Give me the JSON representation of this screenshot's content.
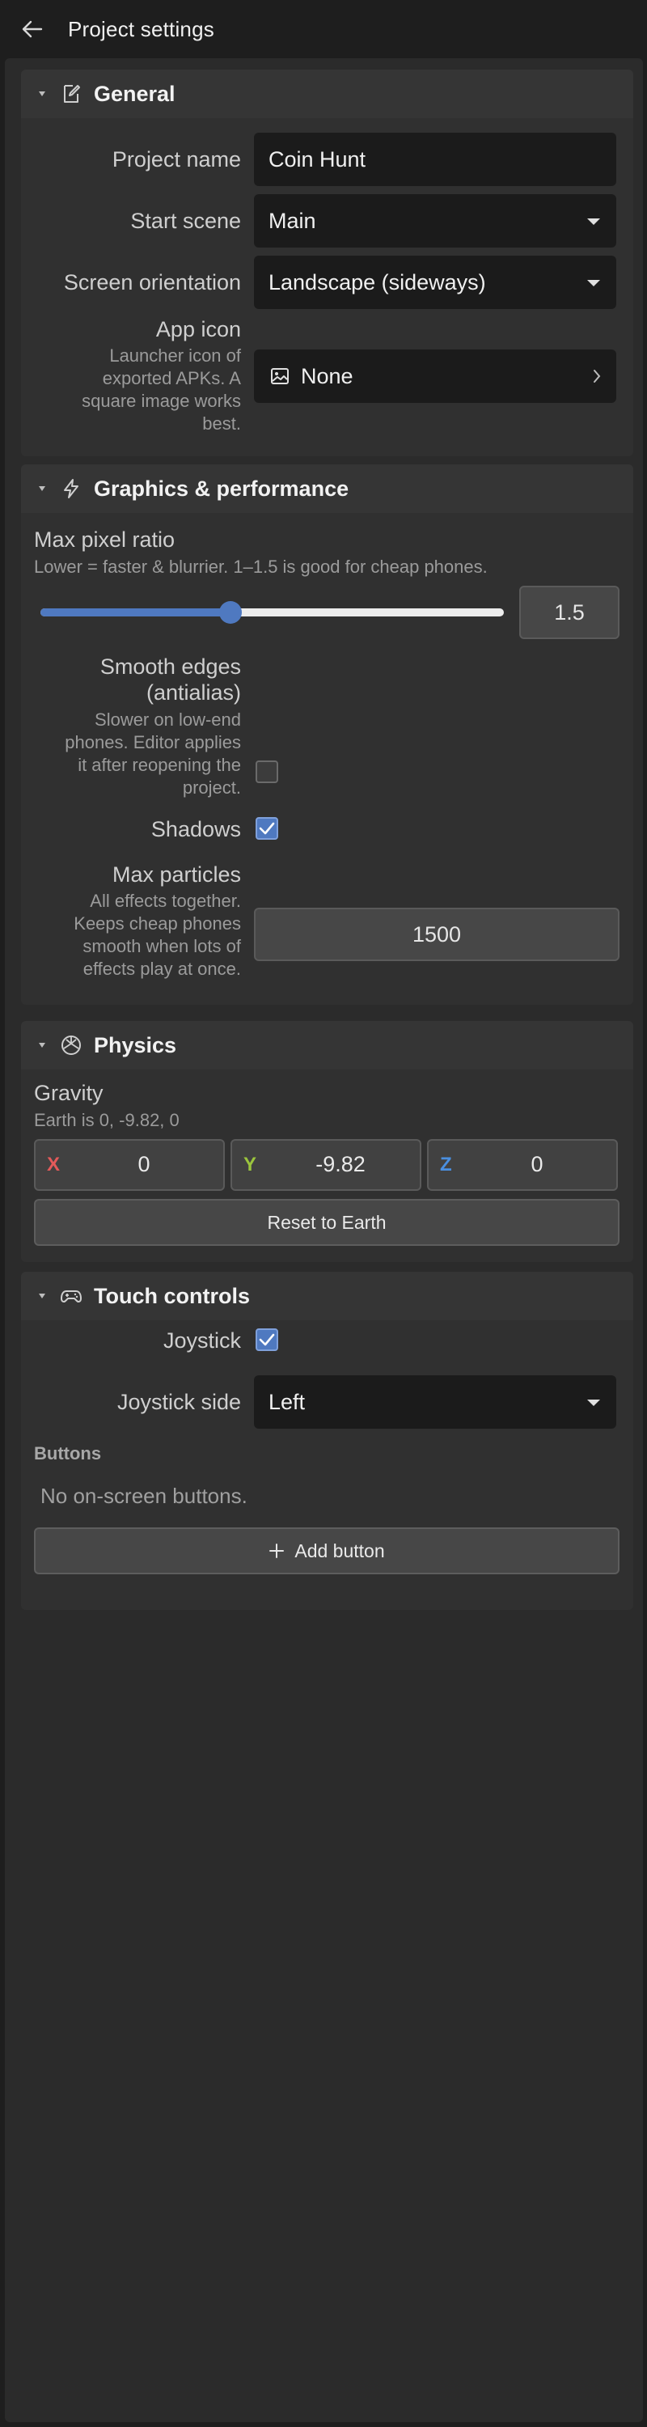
{
  "topbar": {
    "title": "Project settings",
    "back_icon": "arrow-left-icon"
  },
  "general": {
    "title": "General",
    "icon": "edit-document-icon",
    "project_name_label": "Project name",
    "project_name_value": "Coin Hunt",
    "start_scene_label": "Start scene",
    "start_scene_value": "Main",
    "orientation_label": "Screen orientation",
    "orientation_value": "Landscape (sideways)",
    "app_icon_label": "App icon",
    "app_icon_hint": [
      "Launcher icon of",
      "exported APKs. A",
      "square image works",
      "best."
    ],
    "app_icon_value": "None"
  },
  "graphics": {
    "title": "Graphics & performance",
    "icon": "lightning-icon",
    "pixel_ratio_label": "Max pixel ratio",
    "pixel_ratio_hint": "Lower = faster & blurrier. 1–1.5 is good for cheap phones.",
    "pixel_ratio_value": "1.5",
    "pixel_ratio_fraction": 0.41,
    "antialias_label": [
      "Smooth edges",
      "(antialias)"
    ],
    "antialias_hint": [
      "Slower on low-end",
      "phones. Editor applies",
      "it after reopening the",
      "project."
    ],
    "antialias_checked": false,
    "shadows_label": "Shadows",
    "shadows_checked": true,
    "particles_label": "Max particles",
    "particles_hint": [
      "All effects together.",
      "Keeps cheap phones",
      "smooth when lots of",
      "effects play at once."
    ],
    "particles_value": "1500"
  },
  "physics": {
    "title": "Physics",
    "icon": "physics-dice-icon",
    "gravity_label": "Gravity",
    "gravity_hint": "Earth is 0, -9.82, 0",
    "x_axis": "X",
    "x_value": "0",
    "y_axis": "Y",
    "y_value": "-9.82",
    "z_axis": "Z",
    "z_value": "0",
    "reset_label": "Reset to Earth"
  },
  "touch": {
    "title": "Touch controls",
    "icon": "gamepad-icon",
    "joystick_label": "Joystick",
    "joystick_checked": true,
    "joystick_side_label": "Joystick side",
    "joystick_side_value": "Left",
    "buttons_heading": "Buttons",
    "no_buttons_text": "No on-screen buttons.",
    "add_button_label": "Add button"
  },
  "colors": {
    "accent": "#4f79c0",
    "x_axis": "#e35a5a",
    "y_axis": "#9bc53d",
    "z_axis": "#4a8fe0"
  }
}
